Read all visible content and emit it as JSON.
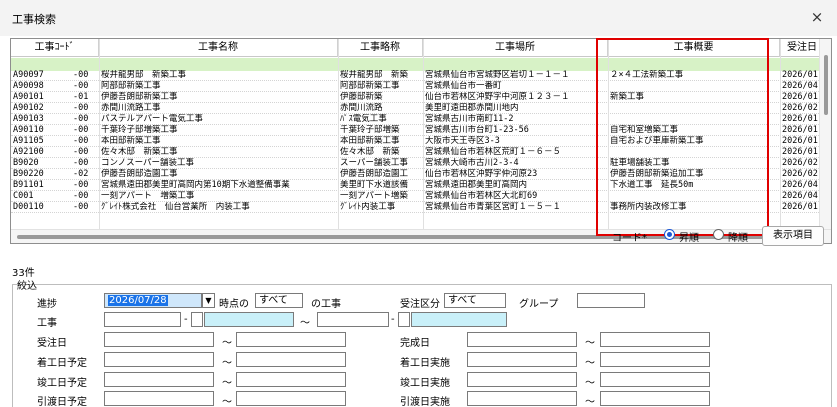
{
  "window": {
    "title": "工事検索",
    "close_label": "×"
  },
  "grid": {
    "columns": [
      {
        "label": "工事ｺｰﾄﾞ"
      },
      {
        "label": "工事名称"
      },
      {
        "label": "工事略称"
      },
      {
        "label": "工事場所"
      },
      {
        "label": "工事概要"
      },
      {
        "label": "受注日"
      }
    ],
    "rows": [
      [
        "A90097",
        "-00",
        "桜井龍男邸　新築工事",
        "桜井龍男邸　新築",
        "宮城県仙台市宮城野区岩切１－１－１",
        "２×４工法新築工事",
        "2026/01,"
      ],
      [
        "A90098",
        "-00",
        "阿部邸新築工事",
        "阿部邸新築工事",
        "宮城県仙台市一番町",
        "",
        "2026/04,"
      ],
      [
        "A90101",
        "-01",
        "伊藤吾朗邸新築工事",
        "伊藤邸新築",
        "仙台市若林区沖野字中河原１２３－１",
        "新築工事",
        "2026/01,"
      ],
      [
        "A90102",
        "-00",
        "赤間川流路工事",
        "赤間川流路",
        "美里町遠田郡赤間川地内",
        "",
        "2026/02,"
      ],
      [
        "A90103",
        "-00",
        "パステルアパート電気工事",
        "ﾊﾟｽ電気工事",
        "宮城県古川市南町11-2",
        "",
        "2026/01,"
      ],
      [
        "A90110",
        "-00",
        "千葉玲子邸増築工事",
        "千葉玲子邸増築",
        "宮城県古川市台町1-23-56",
        "自宅和室増築工事",
        "2026/01,"
      ],
      [
        "A91105",
        "-00",
        "本田邸新築工事",
        "本田邸新築工事",
        "大阪市天王寺区3-3",
        "自宅および車庫新築工事",
        "2026/01,"
      ],
      [
        "A92100",
        "-00",
        "佐々木邸　新築工事",
        "佐々木邸　新築",
        "宮城県仙台市若林区荒町１－６－５",
        "",
        "2026/01,"
      ],
      [
        "B9020",
        "-00",
        "コンノスーパー舗装工事",
        "スーパー舗装工事",
        "宮城県大崎市古川2-3-4",
        "駐車場舗装工事",
        "2026/02,"
      ],
      [
        "B90220",
        "-02",
        "伊藤吾朗邸造園工事",
        "伊藤吾朗邸造園工",
        "仙台市若林区沖野字仲河原23",
        "伊藤吾朗邸新築追加工事",
        "2026/02,"
      ],
      [
        "B91101",
        "-00",
        "宮城県遠田郡美里町高岡内第10期下水道整備事業",
        "美里町下水道該備",
        "宮城県遠田郡美里町高岡内",
        "下水道工事　延長50m",
        "2026/04,"
      ],
      [
        "C001",
        "-00",
        "一刻アパート　増築工事",
        "一刻アパート増築",
        "宮城県仙台市若林区大北町69",
        "",
        "2026/04,"
      ],
      [
        "D00110",
        "-00",
        "ｸﾞﾚｲﾄ株式会社　仙台営業所　内装工事",
        "ｸﾞﾚｲﾄ内装工事",
        "宮城県仙台市青葉区宮町１－５－１",
        "事務所内装改修工事",
        "2026/01,"
      ]
    ]
  },
  "sort": {
    "label": "コード*",
    "asc_label": "昇順",
    "desc_label": "降順",
    "selected": "asc",
    "display_items_label": "表示項目"
  },
  "result_count": "33件",
  "filter": {
    "section_label": "絞込",
    "progress_label": "進捗",
    "date_value": "2026/07/28",
    "dropdown_arrow": "▼",
    "as_of_label": "時点の",
    "progress_value": "すべて",
    "of_works_label": "の工事",
    "order_type_label": "受注区分",
    "order_type_value": "すべて",
    "group_label": "グループ",
    "work_label": "工事",
    "dash": "-",
    "tilde": "～",
    "order_date_label": "受注日",
    "completion_date_label": "完成日",
    "planned_start_label": "着工日予定",
    "actual_start_label": "着工日実施",
    "planned_end_label": "竣工日予定",
    "actual_end_label": "竣工日実施",
    "planned_delivery_label": "引渡日予定",
    "actual_delivery_label": "引渡日実施"
  }
}
